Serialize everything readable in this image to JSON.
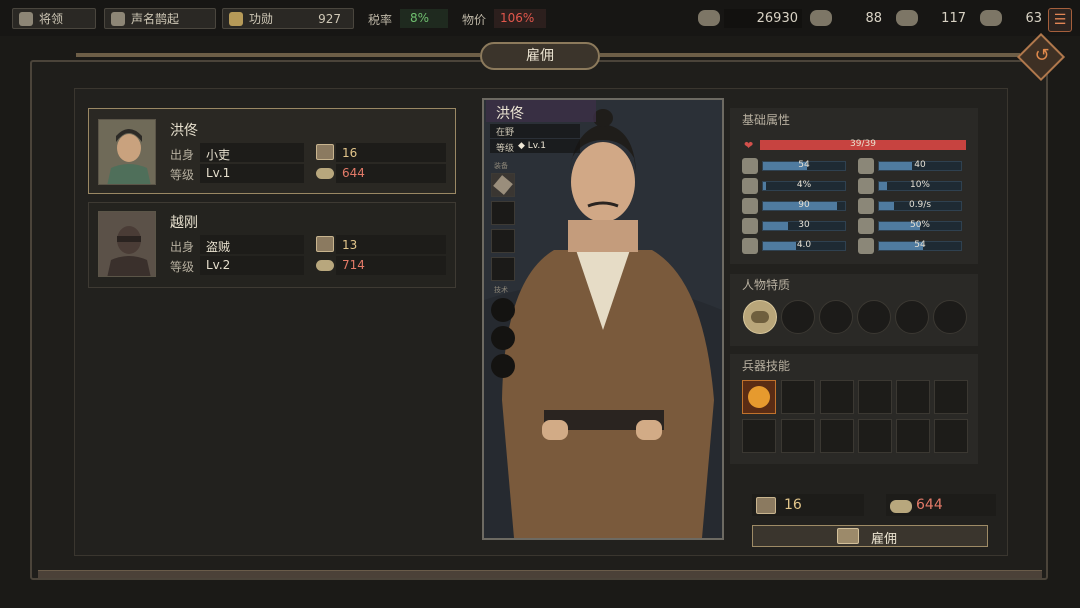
{
  "topbar": {
    "generals_label": "将领",
    "fame_label": "声名鹊起",
    "merit_label": "功勋",
    "merit_value": "927",
    "tax_label": "税率",
    "tax_value": "8%",
    "price_label": "物价",
    "price_value": "106%",
    "resources": [
      {
        "icon": "money-icon",
        "value": "26930"
      },
      {
        "icon": "horse-icon",
        "value": "88"
      },
      {
        "icon": "stone-icon",
        "value": "117"
      },
      {
        "icon": "material-icon",
        "value": "63"
      }
    ]
  },
  "window": {
    "title": "雇佣"
  },
  "candidates": [
    {
      "name": "洪佟",
      "origin_label": "出身",
      "origin": "小吏",
      "level_label": "等级",
      "level": "Lv.1",
      "book_cost": "16",
      "coin_cost": "644"
    },
    {
      "name": "越刚",
      "origin_label": "出身",
      "origin": "盗贼",
      "level_label": "等级",
      "level": "Lv.2",
      "book_cost": "13",
      "coin_cost": "714"
    }
  ],
  "selected": {
    "name": "洪佟",
    "status": "在野",
    "level_label": "等级",
    "level": "◆ Lv.1",
    "equip_label": "装备",
    "skill_label": "技术"
  },
  "attributes": {
    "title": "基础属性",
    "hp_text": "39/39",
    "hp_fraction": 1.0,
    "stats": [
      {
        "icon": "spear-icon",
        "value": "54",
        "fill": 0.54
      },
      {
        "icon": "sword-icon",
        "value": "40",
        "fill": 0.4
      },
      {
        "icon": "hand-icon",
        "value": "4%",
        "fill": 0.04
      },
      {
        "icon": "skull-icon",
        "value": "10%",
        "fill": 0.1
      },
      {
        "icon": "fist-icon",
        "value": "90",
        "fill": 0.9
      },
      {
        "icon": "plant-icon",
        "value": "0.9/s",
        "fill": 0.18
      },
      {
        "icon": "boot-icon",
        "value": "30",
        "fill": 0.3
      },
      {
        "icon": "armor-icon",
        "value": "50%",
        "fill": 0.5
      },
      {
        "icon": "target-icon",
        "value": "4.0",
        "fill": 0.4
      },
      {
        "icon": "cloak-icon",
        "value": "54",
        "fill": 0.54
      }
    ]
  },
  "traits": {
    "title": "人物特质"
  },
  "weapons": {
    "title": "兵器技能"
  },
  "hire": {
    "book_cost": "16",
    "coin_cost": "644",
    "button_label": "雇佣"
  },
  "colors": {
    "hp": "#c74340",
    "stat": "#4f7ba0",
    "tax": "#6fbf6f",
    "price": "#e2574c",
    "accent": "#e08a4c"
  }
}
